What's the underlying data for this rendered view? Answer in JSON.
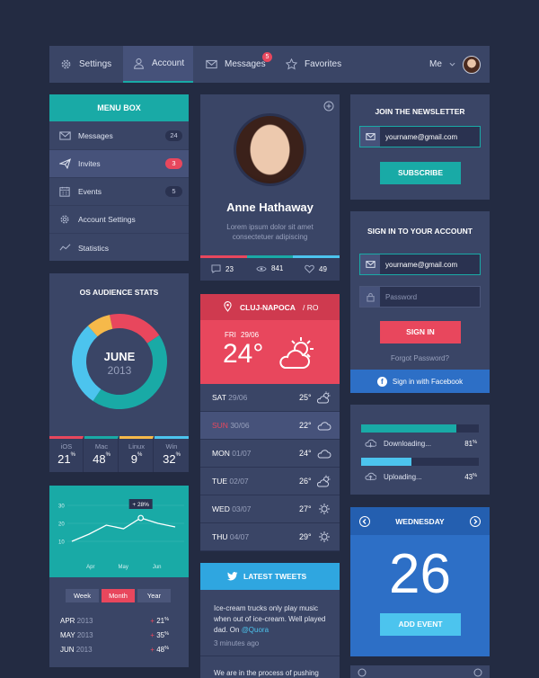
{
  "nav": {
    "items": [
      {
        "label": "Settings"
      },
      {
        "label": "Account"
      },
      {
        "label": "Messages",
        "badge": "5"
      },
      {
        "label": "Favorites"
      }
    ],
    "user_label": "Me"
  },
  "menu": {
    "title": "MENU BOX",
    "items": [
      {
        "label": "Messages",
        "count": "24"
      },
      {
        "label": "Invites",
        "count": "3"
      },
      {
        "label": "Events",
        "count": "5"
      },
      {
        "label": "Account Settings"
      },
      {
        "label": "Statistics"
      }
    ]
  },
  "os_stats": {
    "title": "OS AUDIENCE STATS",
    "month": "JUNE",
    "year": "2013",
    "items": [
      {
        "name": "iOS",
        "value": "21",
        "unit": "%",
        "color": "#e8475d"
      },
      {
        "name": "Mac",
        "value": "48",
        "unit": "%",
        "color": "#19aaa6"
      },
      {
        "name": "Linux",
        "value": "9",
        "unit": "%",
        "color": "#f6b94a"
      },
      {
        "name": "Win",
        "value": "32",
        "unit": "%",
        "color": "#4cc4ee"
      }
    ]
  },
  "chart_data": {
    "type": "line",
    "x": [
      "Apr",
      "",
      "May",
      "",
      "Jun",
      ""
    ],
    "values": [
      10,
      14,
      19,
      17,
      23,
      20,
      18
    ],
    "yticks": [
      "30",
      "20",
      "10"
    ],
    "ylim": [
      0,
      30
    ],
    "xticks": [
      "Apr",
      "May",
      "Jun"
    ],
    "highlight": {
      "label": "28",
      "unit": "%"
    },
    "title": "",
    "xlabel": "",
    "ylabel": ""
  },
  "period_tabs": [
    {
      "label": "Week"
    },
    {
      "label": "Month"
    },
    {
      "label": "Year"
    }
  ],
  "monthly": [
    {
      "label": "APR",
      "year": "2013",
      "value": "+ 21",
      "unit": "%"
    },
    {
      "label": "MAY",
      "year": "2013",
      "value": "+ 35",
      "unit": "%"
    },
    {
      "label": "JUN",
      "year": "2013",
      "value": "+ 48",
      "unit": "%"
    }
  ],
  "profile": {
    "name": "Anne Hathaway",
    "bio": "Lorem ipsum dolor sit amet consectetuer adipiscing",
    "stats": [
      {
        "value": "23"
      },
      {
        "value": "841"
      },
      {
        "value": "49"
      }
    ]
  },
  "weather": {
    "city": "CLUJ-NAPOCA",
    "country": "/ RO",
    "date_day": "FRI",
    "date": "29/06",
    "temp": "24°",
    "forecast": [
      {
        "day": "SAT",
        "date": "29/06",
        "temp": "25°"
      },
      {
        "day": "SUN",
        "date": "30/06",
        "temp": "22°"
      },
      {
        "day": "MON",
        "date": "01/07",
        "temp": "24°"
      },
      {
        "day": "TUE",
        "date": "02/07",
        "temp": "26°"
      },
      {
        "day": "WED",
        "date": "03/07",
        "temp": "27°"
      },
      {
        "day": "THU",
        "date": "04/07",
        "temp": "29°"
      }
    ]
  },
  "tweets": {
    "title": "LATEST TWEETS",
    "items": [
      {
        "text": "Ice-cream trucks only play music when out of ice-cream. Well played dad. On ",
        "link": "@Quora",
        "time": "3 minutes ago"
      },
      {
        "text": "We are in the process of pushing"
      }
    ]
  },
  "newsletter": {
    "title": "JOIN THE NEWSLETTER",
    "email": "yourname@gmail.com",
    "button": "SUBSCRIBE"
  },
  "signin": {
    "title": "SIGN IN TO YOUR ACCOUNT",
    "email": "yourname@gmail.com",
    "password_placeholder": "Password",
    "button": "SIGN IN",
    "forgot": "Forgot Password?",
    "facebook": "Sign in with Facebook"
  },
  "transfers": [
    {
      "label": "Downloading...",
      "value": "81",
      "unit": "%",
      "progress": 0.81,
      "color": "#19aaa6"
    },
    {
      "label": "Uploading...",
      "value": "43",
      "unit": "%",
      "progress": 0.43,
      "color": "#4cc4ee"
    }
  ],
  "calendar": {
    "weekday": "WEDNESDAY",
    "day": "26",
    "button": "ADD EVENT"
  },
  "colors": {
    "background": "#232b42",
    "panel": "#3a4566",
    "teal": "#19aaa6",
    "red": "#e8475d",
    "blue": "#2d6fc6",
    "yellow": "#f6b94a",
    "light_blue": "#4cc4ee"
  }
}
